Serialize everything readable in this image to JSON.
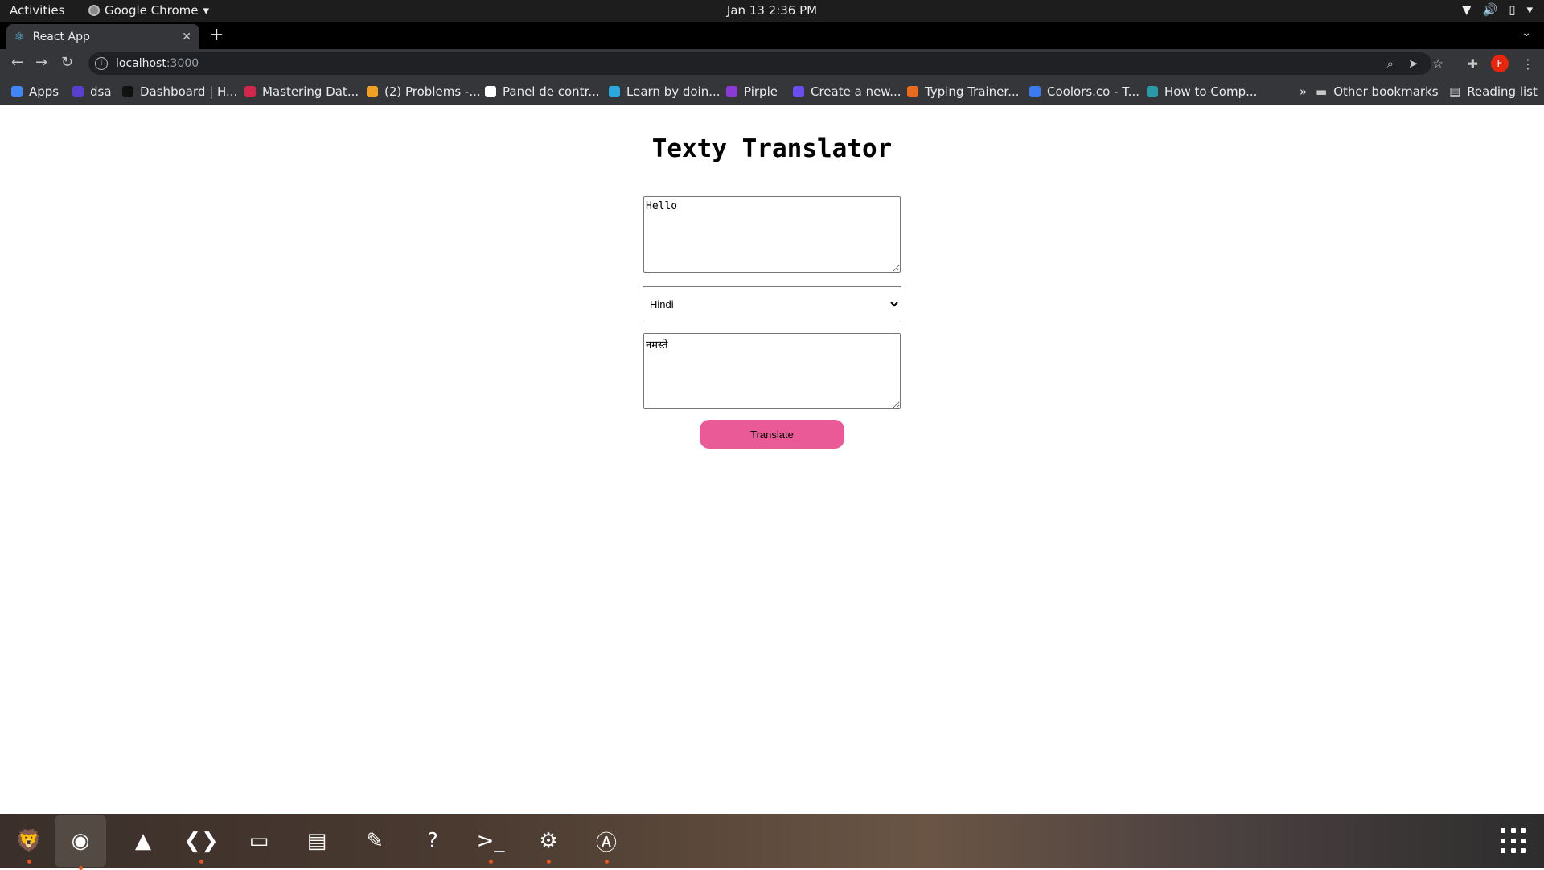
{
  "system": {
    "activities": "Activities",
    "app_name": "Google Chrome",
    "clock": "Jan 13  2:36 PM"
  },
  "browser": {
    "tab_title": "React App",
    "url_host": "localhost",
    "url_port": ":3000",
    "bookmarks": [
      {
        "label": "Apps",
        "color": "#4285f4"
      },
      {
        "label": "dsa",
        "color": "#5b3fd1"
      },
      {
        "label": "Dashboard | H...",
        "color": "#111111"
      },
      {
        "label": "Mastering Dat...",
        "color": "#d2264a"
      },
      {
        "label": "(2) Problems -...",
        "color": "#f0a020"
      },
      {
        "label": "Panel de contr...",
        "color": "#ffffff"
      },
      {
        "label": "Learn by doin...",
        "color": "#2aa8e0"
      },
      {
        "label": "Pirple",
        "color": "#8a3ad6"
      },
      {
        "label": "Create a new...",
        "color": "#6a4cf0"
      },
      {
        "label": "Typing Trainer...",
        "color": "#e86a1c"
      },
      {
        "label": "Coolors.co - T...",
        "color": "#3a7bf0"
      },
      {
        "label": "How to Comp...",
        "color": "#2a9aa8"
      }
    ],
    "other_bookmarks": "Other bookmarks",
    "reading_list": "Reading list",
    "more": "»",
    "avatar_letter": "F"
  },
  "page": {
    "title": "Texty Translator",
    "input_text": "Hello",
    "language_selected": "Hindi",
    "output_text": "नमस्ते",
    "translate_label": "Translate"
  },
  "dock": [
    {
      "name": "brave-icon",
      "glyph": "🦁",
      "running": true
    },
    {
      "name": "chrome-icon",
      "glyph": "◉",
      "running": true,
      "active": true
    },
    {
      "name": "vlc-icon",
      "glyph": "▲",
      "running": false
    },
    {
      "name": "vscode-icon",
      "glyph": "❮❯",
      "running": true
    },
    {
      "name": "files-icon",
      "glyph": "▭",
      "running": false
    },
    {
      "name": "writer-icon",
      "glyph": "▤",
      "running": false
    },
    {
      "name": "text-editor-icon",
      "glyph": "✎",
      "running": false
    },
    {
      "name": "help-icon",
      "glyph": "?",
      "running": false
    },
    {
      "name": "terminal-icon",
      "glyph": ">_",
      "running": true
    },
    {
      "name": "settings-icon",
      "glyph": "⚙",
      "running": true
    },
    {
      "name": "software-icon",
      "glyph": "Ⓐ",
      "running": true
    }
  ]
}
